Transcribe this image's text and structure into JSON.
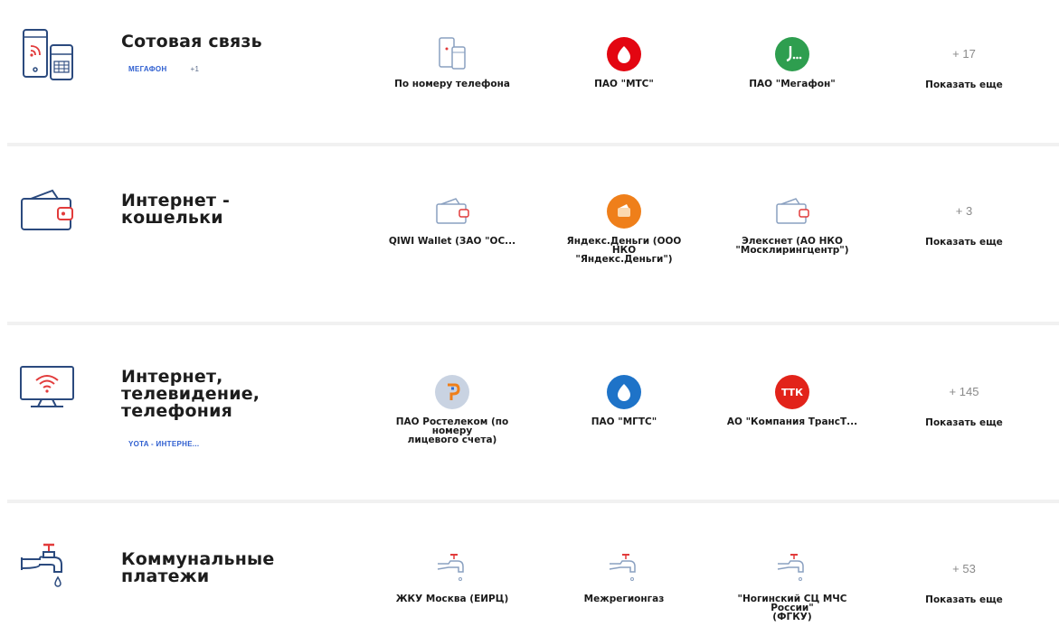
{
  "categories": [
    {
      "title": "Сотовая связь",
      "tags": [
        "МЕГАФОН",
        "+1"
      ],
      "providers": [
        "По номеру телефона",
        "ПАО \"МТС\"",
        "ПАО \"Мегафон\""
      ],
      "more_count": "+ 17",
      "more_label": "Показать еще"
    },
    {
      "title": "Интернет -\nкошельки",
      "providers": [
        "QIWI Wallet (ЗАО \"ОС...",
        "Яндекс.Деньги (ООО\nНКО\n\"Яндекс.Деньги\")",
        "Элекснет (АО НКО\n\"Москлирингцентр\")"
      ],
      "more_count": "+ 3",
      "more_label": "Показать еще"
    },
    {
      "title": "Интернет,\nтелевидение,\nтелефония",
      "tags": [
        "YOTA - ИНТЕРНЕ..."
      ],
      "providers": [
        "ПАО Ростелеком (по\nномеру\nлицевого счета)",
        "ПАО \"МГТС\"",
        "АО \"Компания ТрансТ..."
      ],
      "more_count": "+ 145",
      "more_label": "Показать еще"
    },
    {
      "title": "Коммунальные\nплатежи",
      "providers": [
        "ЖКУ Москва (ЕИРЦ)",
        "Межрегионгаз",
        "\"Ногинский СЦ МЧС\nРоссии\"\n(ФГКУ)"
      ],
      "more_count": "+ 53",
      "more_label": "Показать еще"
    }
  ],
  "logos": {
    "ttk_text": "ТТК"
  },
  "colors": {
    "mts_red": "#e30611",
    "megafon_green": "#2e9e4f",
    "yandex_orange": "#ef7f1a",
    "mgts_blue": "#1e73c8",
    "ttk_red": "#e2231a",
    "tag_blue": "#2f5fd0",
    "accent_red": "#e23b3b",
    "icon_blue": "#2b4a7e"
  }
}
